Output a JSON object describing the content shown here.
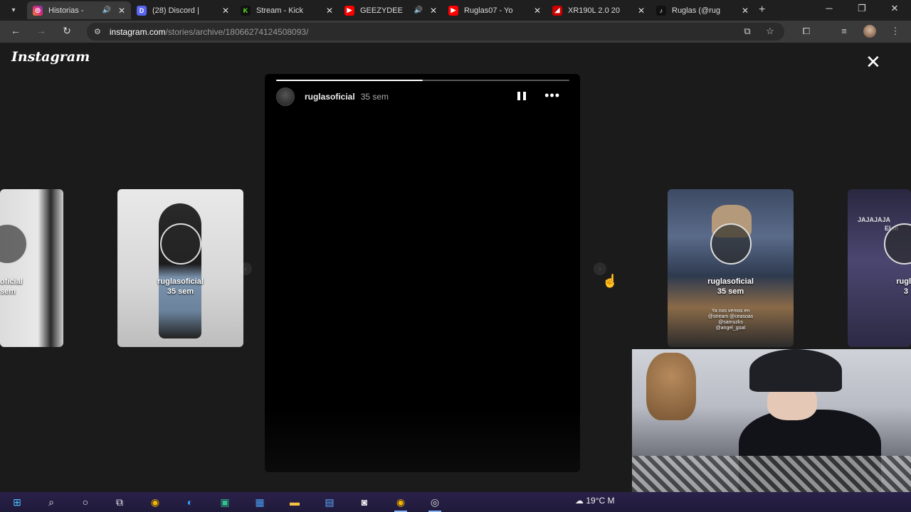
{
  "browser": {
    "tabs": [
      {
        "title": "Historias -",
        "favicon": "instagram-icon",
        "color": "#e1306c",
        "audio": true,
        "active": true
      },
      {
        "title": "(28) Discord |",
        "favicon": "discord-icon",
        "color": "#5865f2",
        "badge": "28",
        "audio": false,
        "active": false
      },
      {
        "title": "Stream - Kick",
        "favicon": "kick-icon",
        "color": "#53fc18",
        "audio": false,
        "active": false
      },
      {
        "title": "GEEZYDEE",
        "favicon": "youtube-icon",
        "color": "#ff0000",
        "audio": true,
        "active": false
      },
      {
        "title": "Ruglas07 - Yo",
        "favicon": "youtube-icon",
        "color": "#ff0000",
        "audio": false,
        "active": false
      },
      {
        "title": "XR190L 2.0 20",
        "favicon": "honda-icon",
        "color": "#cc0000",
        "audio": false,
        "active": false
      },
      {
        "title": "Ruglas (@rug",
        "favicon": "tiktok-icon",
        "color": "#111111",
        "audio": false,
        "active": false
      }
    ],
    "url_domain": "instagram.com",
    "url_path": "/stories/archive/18066274124508093/"
  },
  "page": {
    "logo": "Instagram",
    "story": {
      "username": "ruglasoficial",
      "time": "35 sem",
      "progress": 0.5
    },
    "thumbnails": [
      {
        "name": "oficial",
        "time": "sem"
      },
      {
        "name": "ruglasoficial",
        "time": "35 sem"
      },
      {
        "name": "ruglasoficial",
        "time": "35 sem",
        "overlay": "Ya nos vemos en @stream @ceasoas @samuzks @angel_goat"
      },
      {
        "name": "rugl",
        "time": "3",
        "top_text": "JAJAJAJA",
        "top_text2": "El m"
      }
    ]
  },
  "taskbar": {
    "weather": "19°C",
    "weather_extra": "M"
  }
}
